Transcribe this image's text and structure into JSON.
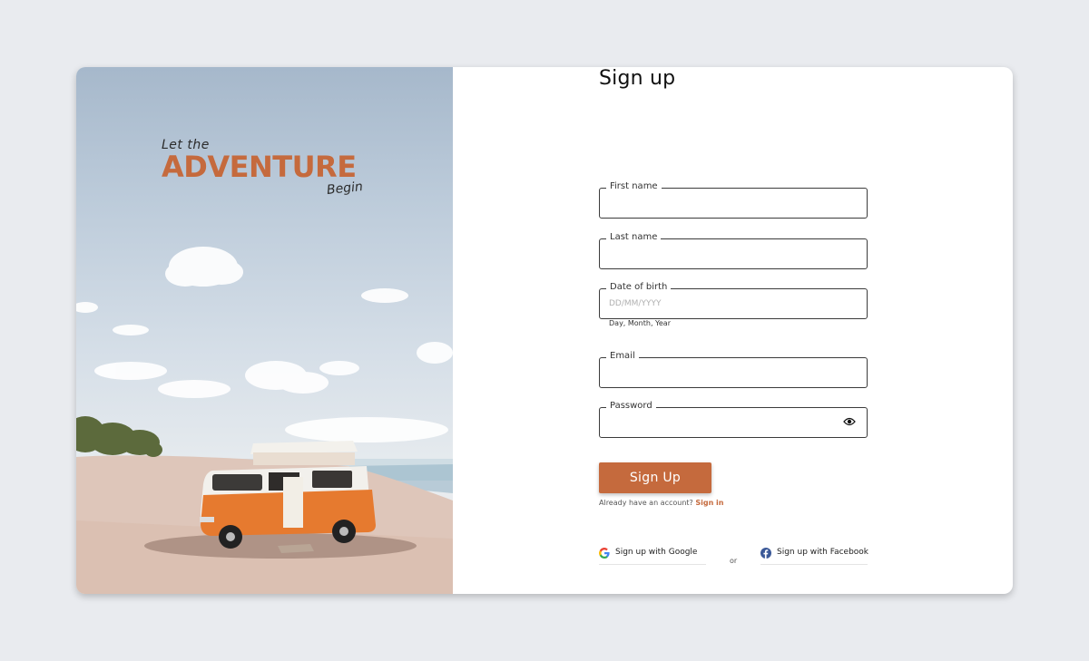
{
  "hero": {
    "tagline_top": "Let the",
    "tagline_main": "ADVENTURE",
    "tagline_bottom": "Begin"
  },
  "form": {
    "title": "Sign up",
    "first_name": {
      "label": "First name",
      "value": ""
    },
    "last_name": {
      "label": "Last name",
      "value": ""
    },
    "dob": {
      "label": "Date of birth",
      "placeholder": "DD/MM/YYYY",
      "hint": "Day, Month, Year",
      "value": ""
    },
    "email": {
      "label": "Email",
      "value": ""
    },
    "password": {
      "label": "Password",
      "value": "",
      "toggle_icon": "eye-icon"
    },
    "submit_label": "Sign Up",
    "signin_prompt": "Already have an account?",
    "signin_link": "Sign in",
    "or_label": "or",
    "google_label": "Sign up with Google",
    "facebook_label": "Sign up with Facebook"
  },
  "colors": {
    "accent": "#c56a3d",
    "page_bg": "#e9ebef",
    "facebook": "#3b5998"
  }
}
